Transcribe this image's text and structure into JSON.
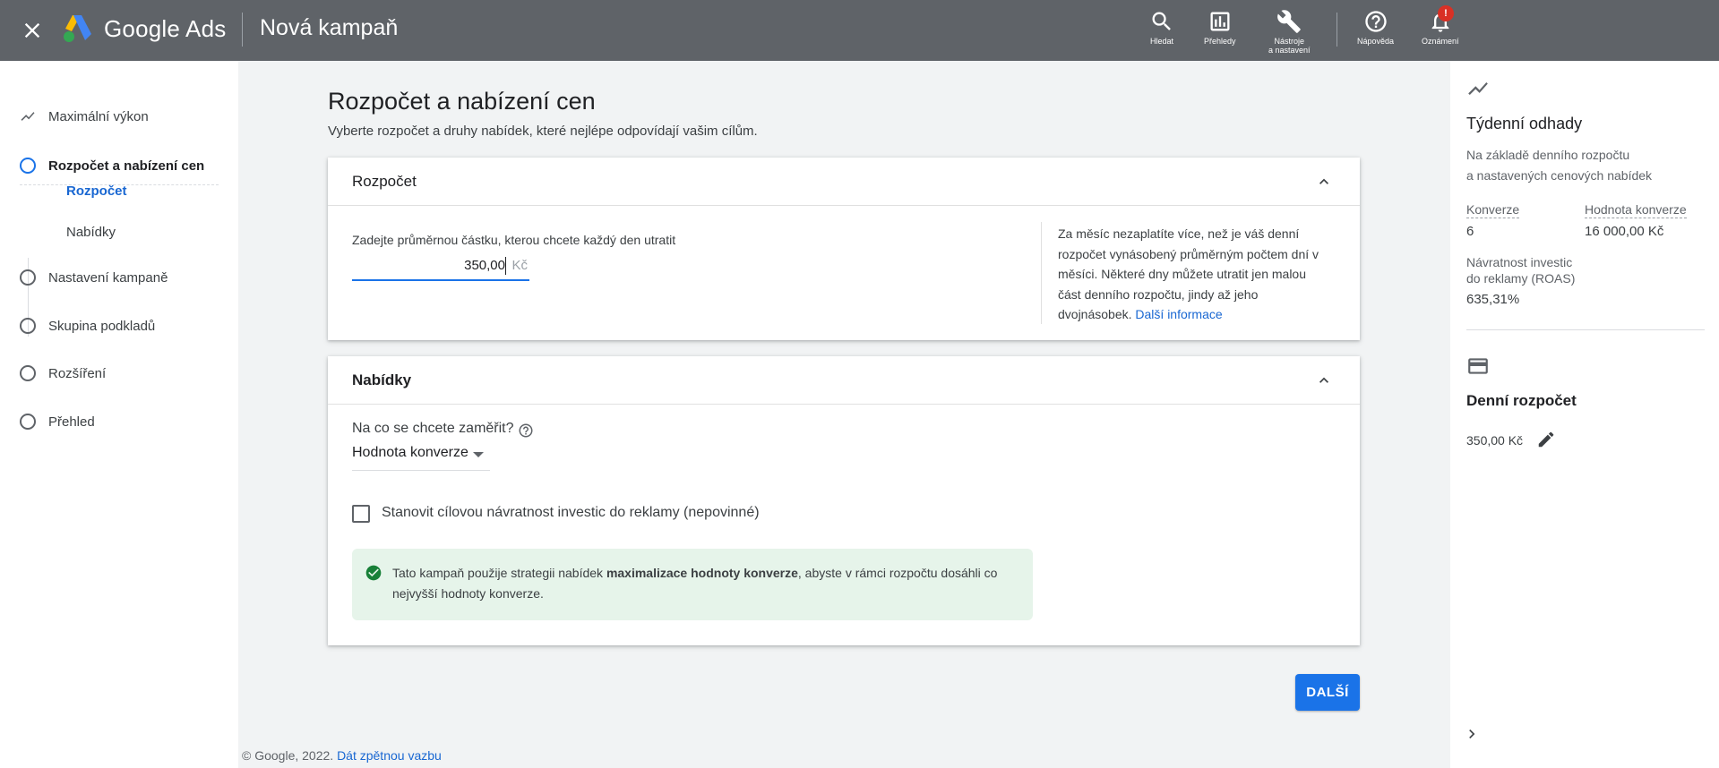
{
  "header": {
    "brand": "Google Ads",
    "page_title": "Nová kampaň",
    "buttons": {
      "search": "Hledat",
      "reports": "Přehledy",
      "tools_line1": "Nástroje",
      "tools_line2": "a nastavení",
      "help": "Nápověda",
      "notifications": "Oznámení",
      "notifications_badge": "!"
    }
  },
  "sidebar": {
    "items": [
      {
        "label": "Maximální výkon"
      },
      {
        "label": "Rozpočet a nabízení cen"
      },
      {
        "label": "Nastavení kampaně"
      },
      {
        "label": "Skupina podkladů"
      },
      {
        "label": "Rozšíření"
      },
      {
        "label": "Přehled"
      }
    ],
    "sub_items": [
      {
        "label": "Rozpočet"
      },
      {
        "label": "Nabídky"
      }
    ]
  },
  "main": {
    "title": "Rozpočet a nabízení cen",
    "subtitle": "Vyberte rozpočet a druhy nabídek, které nejlépe odpovídají vašim cílům.",
    "budget_card": {
      "title": "Rozpočet",
      "input_label": "Zadejte průměrnou částku, kterou chcete každý den utratit",
      "input_value": "350,00",
      "currency": "Kč",
      "info_text": "Za měsíc nezaplatíte více, než je váš denní rozpočet vynásobený průměrným počtem dní v měsíci. Některé dny můžete utratit jen malou část denního rozpočtu, jindy až jeho dvojnásobek.",
      "info_link": "Další informace"
    },
    "bids_card": {
      "title": "Nabídky",
      "question": "Na co se chcete zaměřit?",
      "select_value": "Hodnota konverze",
      "checkbox_label": "Stanovit cílovou návratnost investic do reklamy (nepovinné)",
      "notice_before": "Tato kampaň použije strategii nabídek ",
      "notice_bold": "maximalizace hodnoty konverze",
      "notice_after": ", abyste v rámci rozpočtu dosáhli co nejvyšší hodnoty konverze."
    },
    "next_button": "DALŠÍ"
  },
  "footer": {
    "copyright": "© Google, 2022.",
    "feedback_link": "Dát zpětnou vazbu"
  },
  "right_panel": {
    "weekly_title": "Týdenní odhady",
    "weekly_desc_line1": "Na základě denního rozpočtu",
    "weekly_desc_line2": "a nastavených cenových nabídek",
    "conversions_label": "Konverze",
    "conversions_value": "6",
    "conv_value_label": "Hodnota konverze",
    "conv_value_value": "16 000,00 Kč",
    "roas_label_line1": "Návratnost investic",
    "roas_label_line2": "do reklamy (ROAS)",
    "roas_value": "635,31%",
    "daily_title": "Denní rozpočet",
    "daily_value": "350,00 Kč"
  },
  "colors": {
    "header_bg": "#5f6368",
    "accent": "#1a73e8",
    "link": "#1967d2",
    "notice_bg": "#e6f4ea",
    "success": "#188038",
    "badge": "#d93025"
  }
}
